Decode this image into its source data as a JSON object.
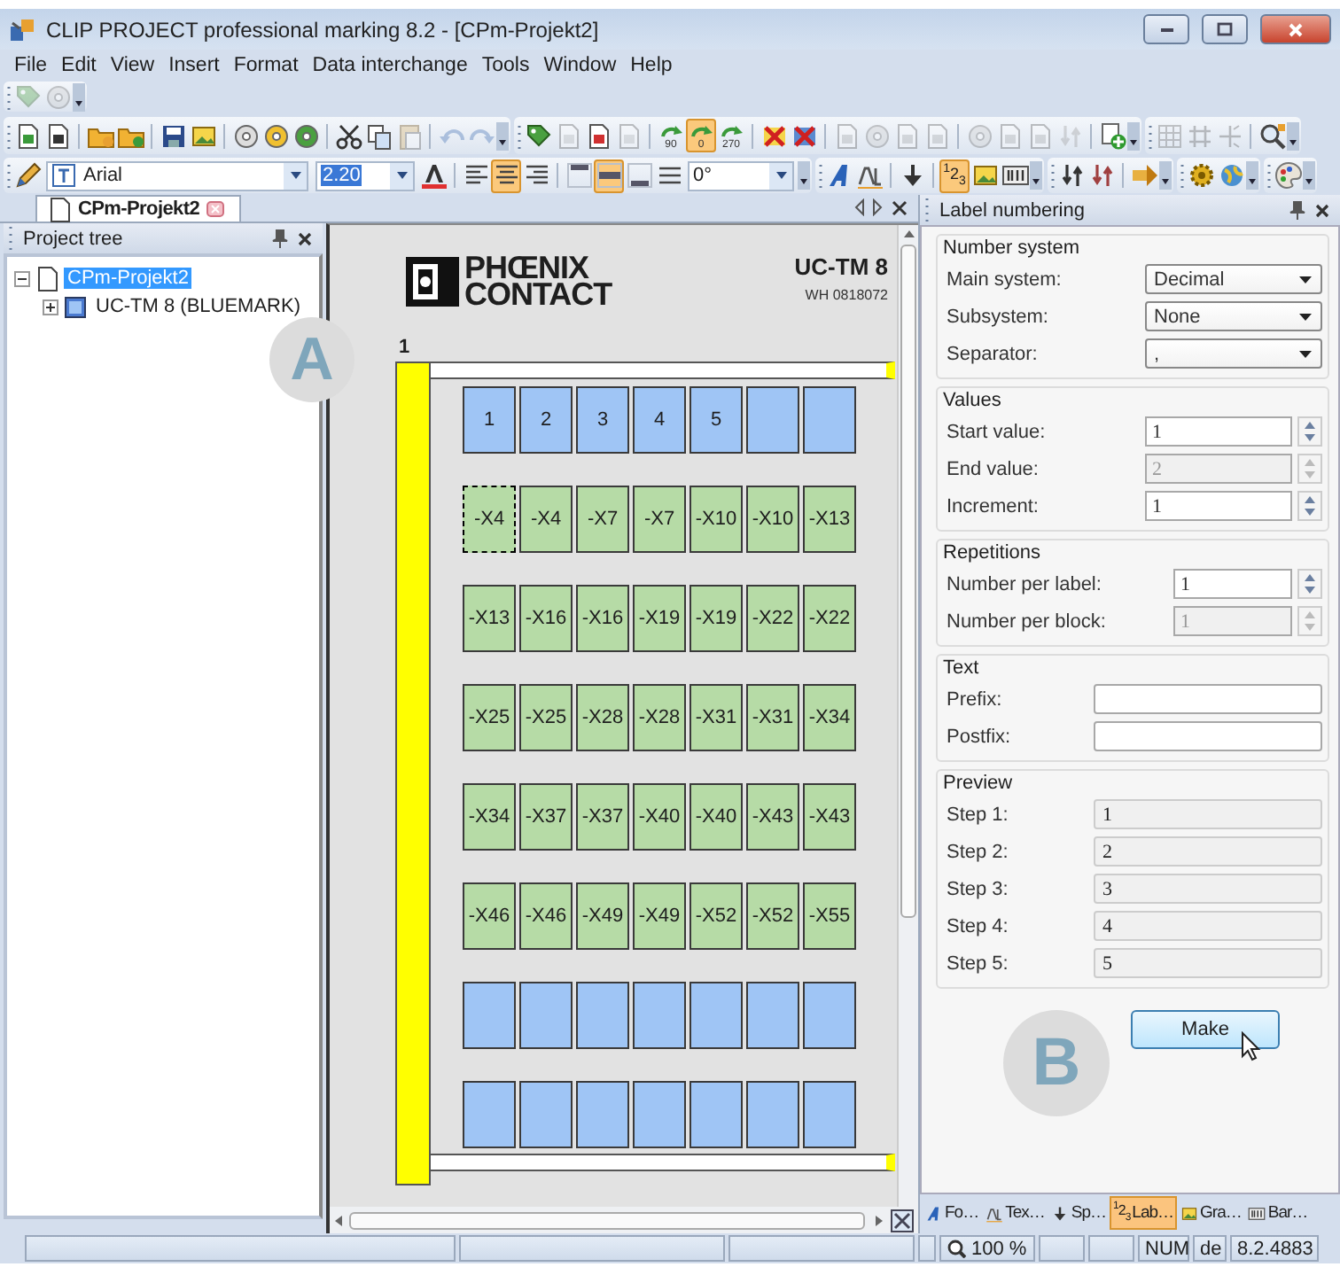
{
  "window": {
    "title": "CLIP PROJECT professional marking 8.2 - [CPm-Projekt2]"
  },
  "menu": [
    "File",
    "Edit",
    "View",
    "Insert",
    "Format",
    "Data interchange",
    "Tools",
    "Window",
    "Help"
  ],
  "toolbars": {
    "quick": [
      [
        {
          "kind": "button",
          "pressed": false,
          "disabled": true
        },
        {
          "kind": "button",
          "pressed": false,
          "disabled": true
        }
      ]
    ],
    "standard": [
      [
        {
          "kind": "button",
          "pressed": false,
          "disabled": false
        },
        {
          "kind": "button",
          "pressed": false,
          "disabled": false
        },
        {
          "kind": "separator"
        },
        {
          "kind": "button",
          "pressed": false,
          "disabled": false
        },
        {
          "kind": "button",
          "pressed": false,
          "disabled": false
        },
        {
          "kind": "separator"
        },
        {
          "kind": "button",
          "pressed": false,
          "disabled": false
        },
        {
          "kind": "button",
          "pressed": false,
          "disabled": false
        },
        {
          "kind": "separator"
        },
        {
          "kind": "button",
          "pressed": false,
          "disabled": false
        },
        {
          "kind": "button",
          "pressed": false,
          "disabled": false
        },
        {
          "kind": "button",
          "pressed": false,
          "disabled": false
        },
        {
          "kind": "separator"
        },
        {
          "kind": "button",
          "pressed": false,
          "disabled": false
        },
        {
          "kind": "button",
          "pressed": false,
          "disabled": false
        },
        {
          "kind": "button",
          "pressed": false,
          "disabled": true
        },
        {
          "kind": "separator"
        },
        {
          "kind": "button",
          "pressed": false,
          "disabled": true
        },
        {
          "kind": "button",
          "pressed": false,
          "disabled": true
        }
      ],
      [
        {
          "kind": "button",
          "pressed": false,
          "disabled": false
        },
        {
          "kind": "button",
          "pressed": false,
          "disabled": true
        },
        {
          "kind": "button",
          "pressed": false,
          "disabled": false
        },
        {
          "kind": "button",
          "pressed": false,
          "disabled": true
        },
        {
          "kind": "separator"
        },
        {
          "kind": "button",
          "pressed": false,
          "disabled": false,
          "label": "90"
        },
        {
          "kind": "button",
          "pressed": true,
          "disabled": false,
          "label": "0"
        },
        {
          "kind": "button",
          "pressed": false,
          "disabled": false,
          "label": "270"
        },
        {
          "kind": "separator"
        },
        {
          "kind": "button",
          "pressed": false,
          "disabled": false
        },
        {
          "kind": "button",
          "pressed": false,
          "disabled": false
        },
        {
          "kind": "separator"
        },
        {
          "kind": "button",
          "pressed": false,
          "disabled": true
        },
        {
          "kind": "button",
          "pressed": false,
          "disabled": true
        },
        {
          "kind": "button",
          "pressed": false,
          "disabled": true
        },
        {
          "kind": "button",
          "pressed": false,
          "disabled": true
        },
        {
          "kind": "separator"
        },
        {
          "kind": "button",
          "pressed": false,
          "disabled": true
        },
        {
          "kind": "button",
          "pressed": false,
          "disabled": true
        },
        {
          "kind": "button",
          "pressed": false,
          "disabled": true
        },
        {
          "kind": "button",
          "pressed": false,
          "disabled": true
        },
        {
          "kind": "separator"
        },
        {
          "kind": "button",
          "pressed": false,
          "disabled": false
        }
      ],
      [
        {
          "kind": "button",
          "pressed": false,
          "disabled": true
        },
        {
          "kind": "button",
          "pressed": false,
          "disabled": true
        },
        {
          "kind": "button",
          "pressed": false,
          "disabled": true
        },
        {
          "kind": "separator"
        },
        {
          "kind": "button",
          "pressed": false,
          "disabled": false
        }
      ]
    ],
    "format": [
      [
        {
          "kind": "button",
          "pressed": false,
          "disabled": false
        },
        {
          "kind": "combo",
          "value": "Arial",
          "highlighted": false
        },
        {
          "kind": "combo",
          "value": "2.20",
          "highlighted": true
        },
        {
          "kind": "button",
          "pressed": false,
          "disabled": false
        },
        {
          "kind": "separator"
        },
        {
          "kind": "button",
          "pressed": false,
          "disabled": false
        },
        {
          "kind": "button",
          "pressed": true,
          "disabled": false
        },
        {
          "kind": "button",
          "pressed": false,
          "disabled": false
        },
        {
          "kind": "separator"
        },
        {
          "kind": "button",
          "pressed": false,
          "disabled": false
        },
        {
          "kind": "button",
          "pressed": true,
          "disabled": false
        },
        {
          "kind": "button",
          "pressed": false,
          "disabled": false
        },
        {
          "kind": "button",
          "pressed": false,
          "disabled": false
        },
        {
          "kind": "combo",
          "value": "0°",
          "highlighted": false
        }
      ],
      [
        {
          "kind": "button",
          "pressed": false,
          "disabled": false
        },
        {
          "kind": "button",
          "pressed": false,
          "disabled": false
        },
        {
          "kind": "separator"
        },
        {
          "kind": "button",
          "pressed": false,
          "disabled": false
        },
        {
          "kind": "separator"
        },
        {
          "kind": "button",
          "pressed": true,
          "disabled": false,
          "label": "$^{1}$2$_{3}$"
        },
        {
          "kind": "button",
          "pressed": false,
          "disabled": false
        },
        {
          "kind": "button",
          "pressed": false,
          "disabled": false
        }
      ],
      [
        {
          "kind": "button",
          "pressed": false,
          "disabled": false
        },
        {
          "kind": "button",
          "pressed": false,
          "disabled": false
        },
        {
          "kind": "separator"
        },
        {
          "kind": "button",
          "pressed": false,
          "disabled": false
        }
      ],
      [
        {
          "kind": "button",
          "pressed": false,
          "disabled": false
        },
        {
          "kind": "button",
          "pressed": false,
          "disabled": false
        }
      ],
      [
        {
          "kind": "button",
          "pressed": false,
          "disabled": false
        }
      ]
    ]
  },
  "document_tabs": [
    {
      "label": "CPm-Projekt2",
      "selected": true
    }
  ],
  "project_tree": {
    "title": "Project tree",
    "items": [
      {
        "label": "CPm-Projekt2",
        "selected": true,
        "expanded": true,
        "children": [
          {
            "label": "UC-TM 8 (BLUEMARK)",
            "selected": false,
            "expanded": false
          }
        ]
      }
    ]
  },
  "sheet": {
    "brand": [
      "PHŒNIX",
      "CONTACT"
    ],
    "product": "UC-TM 8",
    "article": "WH 0818072",
    "block_number": "1",
    "rows": [
      {
        "color": "#9fc5f5",
        "cells": [
          {
            "text": "1",
            "selected": false
          },
          {
            "text": "2",
            "selected": false
          },
          {
            "text": "3",
            "selected": false
          },
          {
            "text": "4",
            "selected": false
          },
          {
            "text": "5",
            "selected": false
          },
          {
            "selected": false
          },
          {
            "selected": false
          }
        ]
      },
      {
        "color": "#b6dba6",
        "cells": [
          {
            "text": "-X4",
            "selected": true
          },
          {
            "text": "-X4",
            "selected": false
          },
          {
            "text": "-X7",
            "selected": false
          },
          {
            "text": "-X7",
            "selected": false
          },
          {
            "text": "-X10",
            "selected": false
          },
          {
            "text": "-X10",
            "selected": false
          },
          {
            "text": "-X13",
            "selected": false
          }
        ]
      },
      {
        "color": "#b6dba6",
        "cells": [
          {
            "text": "-X13",
            "selected": false
          },
          {
            "text": "-X16",
            "selected": false
          },
          {
            "text": "-X16",
            "selected": false
          },
          {
            "text": "-X19",
            "selected": false
          },
          {
            "text": "-X19",
            "selected": false
          },
          {
            "text": "-X22",
            "selected": false
          },
          {
            "text": "-X22",
            "selected": false
          }
        ]
      },
      {
        "color": "#b6dba6",
        "cells": [
          {
            "text": "-X25",
            "selected": false
          },
          {
            "text": "-X25",
            "selected": false
          },
          {
            "text": "-X28",
            "selected": false
          },
          {
            "text": "-X28",
            "selected": false
          },
          {
            "text": "-X31",
            "selected": false
          },
          {
            "text": "-X31",
            "selected": false
          },
          {
            "text": "-X34",
            "selected": false
          }
        ]
      },
      {
        "color": "#b6dba6",
        "cells": [
          {
            "text": "-X34",
            "selected": false
          },
          {
            "text": "-X37",
            "selected": false
          },
          {
            "text": "-X37",
            "selected": false
          },
          {
            "text": "-X40",
            "selected": false
          },
          {
            "text": "-X40",
            "selected": false
          },
          {
            "text": "-X43",
            "selected": false
          },
          {
            "text": "-X43",
            "selected": false
          }
        ]
      },
      {
        "color": "#b6dba6",
        "cells": [
          {
            "text": "-X46",
            "selected": false
          },
          {
            "text": "-X46",
            "selected": false
          },
          {
            "text": "-X49",
            "selected": false
          },
          {
            "text": "-X49",
            "selected": false
          },
          {
            "text": "-X52",
            "selected": false
          },
          {
            "text": "-X52",
            "selected": false
          },
          {
            "text": "-X55",
            "selected": false
          }
        ]
      },
      {
        "color": "#9fc5f5",
        "cells": [
          {
            "selected": false
          },
          {
            "selected": false
          },
          {
            "selected": false
          },
          {
            "selected": false
          },
          {
            "selected": false
          },
          {
            "selected": false
          },
          {
            "selected": false
          }
        ]
      },
      {
        "color": "#9fc5f5",
        "cells": [
          {
            "selected": false
          },
          {
            "selected": false
          },
          {
            "selected": false
          },
          {
            "selected": false
          },
          {
            "selected": false
          },
          {
            "selected": false
          },
          {
            "selected": false
          }
        ]
      }
    ]
  },
  "label_numbering": {
    "title": "Label numbering",
    "groups": [
      {
        "title": "Number system",
        "fields": [
          {
            "kind": "dropdown",
            "label": "Main system:",
            "value": "Decimal",
            "disabled": false
          },
          {
            "kind": "dropdown",
            "label": "Subsystem:",
            "value": "None",
            "disabled": false
          },
          {
            "kind": "dropdown",
            "label": "Separator:",
            "value": ",",
            "disabled": false
          }
        ]
      },
      {
        "title": "Values",
        "fields": [
          {
            "kind": "spinner",
            "label": "Start value:",
            "value": "1",
            "disabled": false
          },
          {
            "kind": "spinner",
            "label": "End value:",
            "value": "2",
            "disabled": true
          },
          {
            "kind": "spinner",
            "label": "Increment:",
            "value": "1",
            "disabled": false
          }
        ]
      },
      {
        "title": "Repetitions",
        "fields": [
          {
            "kind": "spinner",
            "label": "Number per label:",
            "value": "1",
            "disabled": false
          },
          {
            "kind": "spinner",
            "label": "Number per block:",
            "value": "1",
            "disabled": true
          }
        ]
      },
      {
        "title": "Text",
        "fields": [
          {
            "kind": "text",
            "label": "Prefix:",
            "disabled": false
          },
          {
            "kind": "text",
            "label": "Postfix:",
            "disabled": false
          }
        ]
      },
      {
        "title": "Preview",
        "fields": [
          {
            "kind": "readonly",
            "label": "Step 1:",
            "value": "1"
          },
          {
            "kind": "readonly",
            "label": "Step 2:",
            "value": "2"
          },
          {
            "kind": "readonly",
            "label": "Step 3:",
            "value": "3"
          },
          {
            "kind": "readonly",
            "label": "Step 4:",
            "value": "4"
          },
          {
            "kind": "readonly",
            "label": "Step 5:",
            "value": "5"
          }
        ]
      }
    ],
    "button": "Make"
  },
  "panel_tabs": [
    {
      "label": "Fo…",
      "selected": false
    },
    {
      "label": "Tex…",
      "selected": false
    },
    {
      "label": "Sp…",
      "selected": false
    },
    {
      "label": "Lab…",
      "selected": true,
      "icon_label": "$^{1}$2$_{3}$"
    },
    {
      "label": "Gra…",
      "selected": false
    },
    {
      "label": "Bar…",
      "selected": false
    }
  ],
  "status_bar": {
    "zoom": "100 %",
    "num_lock": "NUM",
    "language": "de",
    "version": "8.2.4883"
  },
  "callouts": [
    {
      "letter": "A"
    },
    {
      "letter": "B"
    }
  ]
}
